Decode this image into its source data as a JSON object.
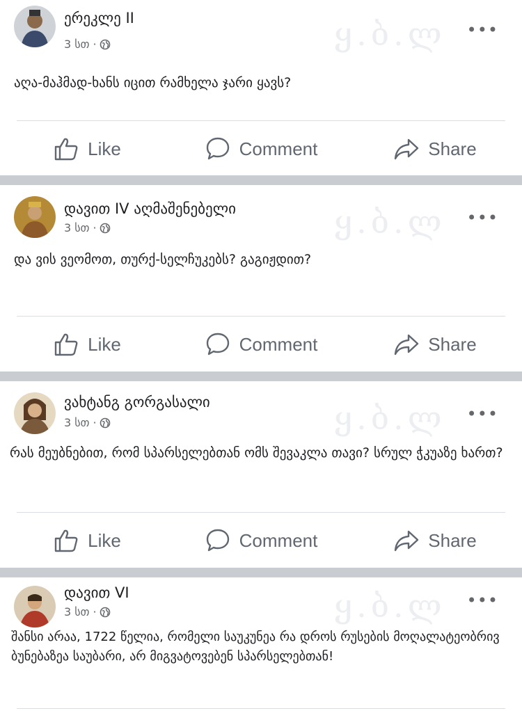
{
  "actions": {
    "like": "Like",
    "comment": "Comment",
    "share": "Share"
  },
  "watermark": "ყ.ბ.ლ",
  "posts": [
    {
      "author": "ერეკლე II",
      "time": "3 სთ ·",
      "text": "აღა-მაჰმად-ხანს იცით რამხელა ჯარი ყავს?"
    },
    {
      "author": "დავით IV აღმაშენებელი",
      "time": "3 სთ ·",
      "text": "და ვის ვეომოთ, თურქ-სელჩუკებს? გაგიჟდით?"
    },
    {
      "author": "ვახტანგ გორგასალი",
      "time": "3 სთ ·",
      "text": "რას მეუბნებით, რომ სპარსელებთან ომს შევაკლა თავი? სრულ ჭკუაზე ხართ?"
    },
    {
      "author": "დავით VI",
      "time": "3 სთ ·",
      "text": "შანსი არაა, 1722 წელია, რომელი საუკუნეა რა დროს რუსების მოღალატეობრივ ბუნებაზეა საუბარი, არ მიგვატოვებენ სპარსელებთან!"
    }
  ]
}
